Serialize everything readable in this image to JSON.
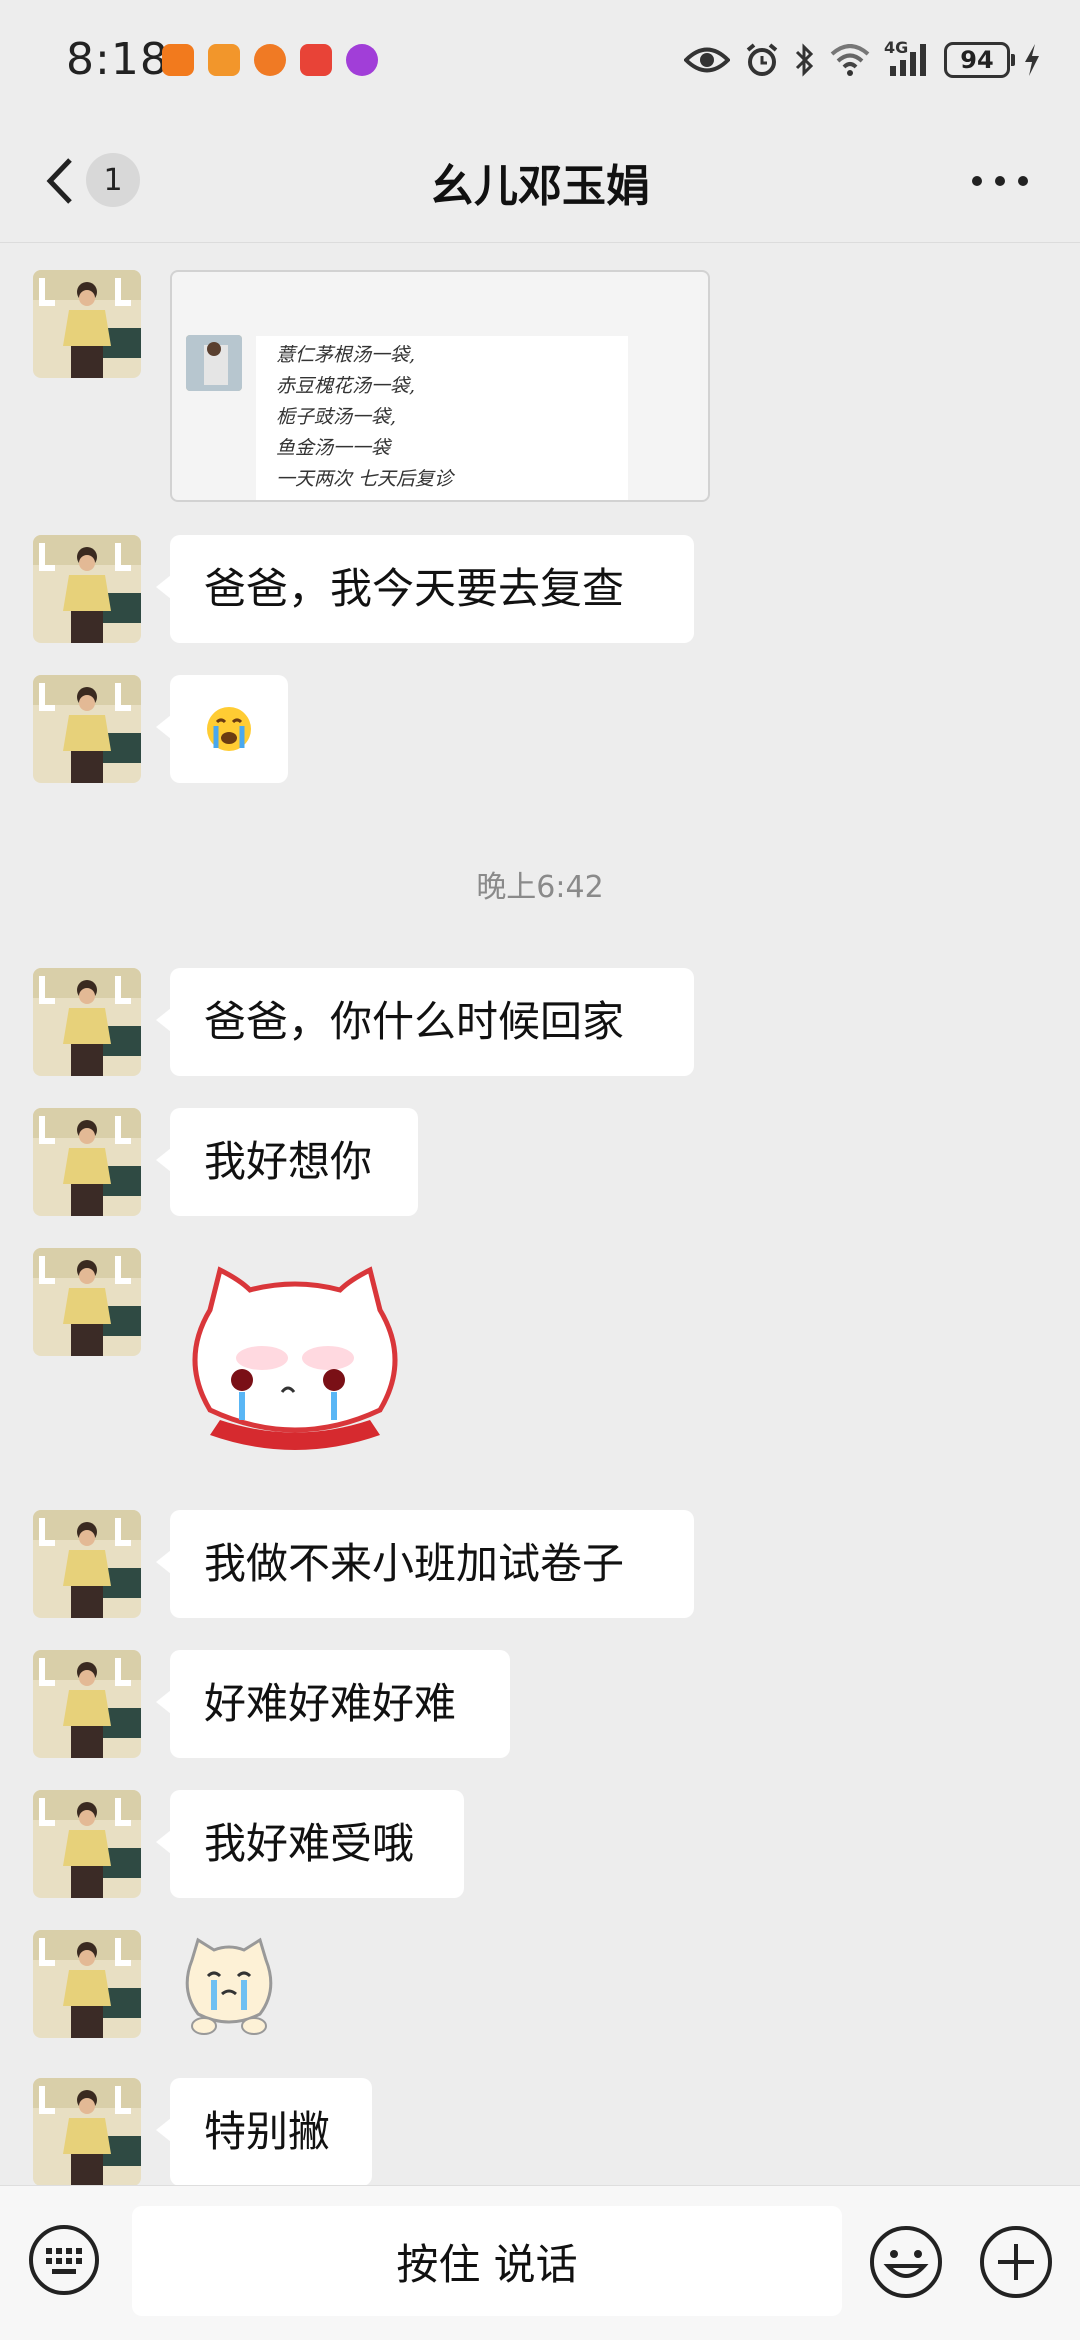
{
  "status_bar": {
    "time": "8:18",
    "network": "4G",
    "battery": "94",
    "app_icons": [
      "camera-icon",
      "mail-icon",
      "browser-icon",
      "news-icon",
      "circle-app-icon"
    ]
  },
  "header": {
    "unread_count": "1",
    "title": "幺儿邓玉娟"
  },
  "chat": {
    "image_note_lines": [
      "薏仁茅根汤一袋,",
      "赤豆槐花汤一袋,",
      "栀子豉汤一袋,",
      "鱼金汤一一袋",
      "一天两次  七天后复诊"
    ],
    "messages": [
      {
        "type": "text",
        "text": "爸爸，我今天要去复查"
      },
      {
        "type": "emoji",
        "emoji": "😭"
      },
      {
        "type": "text",
        "text": "爸爸，你什么时候回家"
      },
      {
        "type": "text",
        "text": "我好想你"
      },
      {
        "type": "sticker",
        "name": "crying-cat-sticker"
      },
      {
        "type": "text",
        "text": "我做不来小班加试卷子"
      },
      {
        "type": "text",
        "text": "好难好难好难"
      },
      {
        "type": "text",
        "text": "我好难受哦"
      },
      {
        "type": "sticker",
        "name": "crying-small-cat-sticker"
      },
      {
        "type": "text",
        "text": "特别撇"
      }
    ],
    "timestamp": "晚上6:42"
  },
  "input_bar": {
    "hold_to_talk_label": "按住 说话"
  },
  "colors": {
    "background": "#ededed",
    "bubble": "#ffffff",
    "timestamp": "#8a8a8a"
  }
}
